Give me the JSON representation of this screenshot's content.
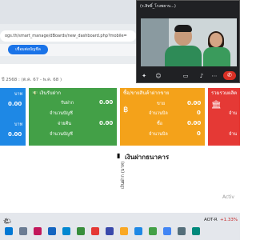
{
  "browser": {
    "address": "ogs.th/smart_manage/dBoards/new_dashboard.php?mobile=",
    "sync_button": "เชื่อมต่อบัญชีล"
  },
  "video_call": {
    "window_title": "(ร.สิทธิ์_โรงพยาบ...)"
  },
  "page": {
    "subtitle": "ปี 2568 : (ต.ค. 67 - พ.ค. 68 )"
  },
  "cards": {
    "blue": {
      "unit1": "บาท",
      "value1": "0.00",
      "unit2": "บาท",
      "value2": "0.00"
    },
    "green": {
      "title": "เงินรับฝาก",
      "rows": [
        {
          "label": "รับฝาก",
          "value": "0.00"
        },
        {
          "label": "จำนวนบัญชี",
          "value": ""
        },
        {
          "label": "จ่ายคืน",
          "value": "0.00"
        },
        {
          "label": "จำนวนบัญชี",
          "value": ""
        }
      ]
    },
    "orange": {
      "title": "ซื้อ/ขายสินค้าฝากขาย",
      "rows": [
        {
          "label": "ขาย",
          "value": "0.00"
        },
        {
          "label": "จำนวนบิล",
          "value": "0"
        },
        {
          "label": "ซื้อ",
          "value": "0.00"
        },
        {
          "label": "จำนวนบิล",
          "value": "0"
        }
      ]
    },
    "red": {
      "title": "รวมรวมผลิต",
      "row1": "จำน",
      "row2": "จำน"
    }
  },
  "chart": {
    "title": "เงินฝากธนาคาร",
    "ylabel": "เงินฝาก (บาท)"
  },
  "windows_watermark": "Activ",
  "taskbar": {
    "tray": "AOT-R",
    "stock": "+1.33%"
  },
  "colors": {
    "blue": "#1e88e5",
    "green": "#43a047",
    "orange": "#f4a21a",
    "red": "#e53935"
  }
}
